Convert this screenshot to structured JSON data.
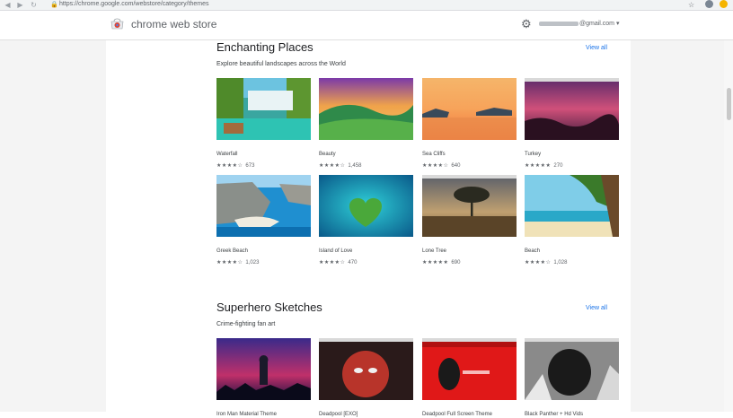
{
  "browser": {
    "url": "https://chrome.google.com/webstore/category/themes"
  },
  "header": {
    "store_name": "chrome web store",
    "account_suffix": "@gmail.com",
    "account_caret": "▾"
  },
  "sections": [
    {
      "title": "Enchanting Places",
      "subtitle": "Explore beautiful landscapes across the World",
      "view_all": "View all",
      "items": [
        {
          "name": "Waterfall",
          "stars": "★★★★☆",
          "count": "673"
        },
        {
          "name": "Beauty",
          "stars": "★★★★☆",
          "count": "1,458"
        },
        {
          "name": "Sea Cliffs",
          "stars": "★★★★☆",
          "count": "640"
        },
        {
          "name": "Turkey",
          "stars": "★★★★★",
          "count": "270"
        },
        {
          "name": "Greek Beach",
          "stars": "★★★★☆",
          "count": "1,023"
        },
        {
          "name": "Island of Love",
          "stars": "★★★★☆",
          "count": "470"
        },
        {
          "name": "Lone Tree",
          "stars": "★★★★★",
          "count": "690"
        },
        {
          "name": "Beach",
          "stars": "★★★★☆",
          "count": "1,028"
        }
      ]
    },
    {
      "title": "Superhero Sketches",
      "subtitle": "Crime-fighting fan art",
      "view_all": "View all",
      "items": [
        {
          "name": "Iron Man Material Theme"
        },
        {
          "name": "Deadpool [EXO]"
        },
        {
          "name": "Deadpool Full Screen Theme"
        },
        {
          "name": "Black Panther + Hd Vids"
        }
      ]
    }
  ]
}
